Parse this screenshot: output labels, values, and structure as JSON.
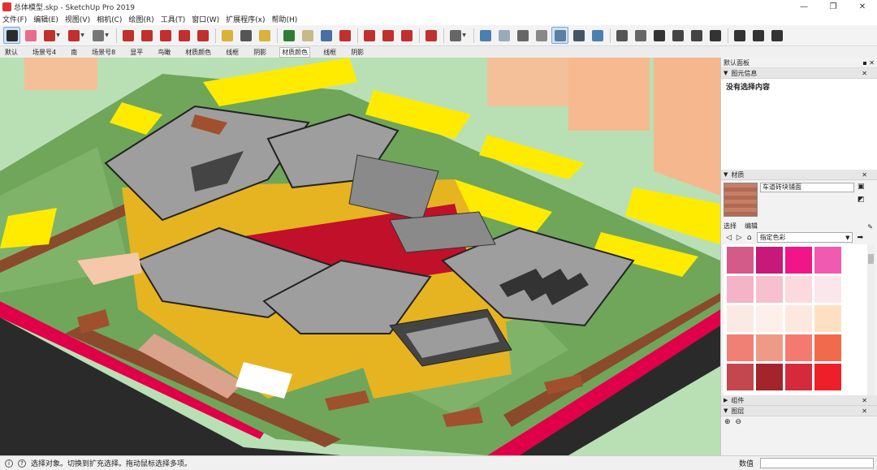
{
  "window": {
    "title": "总体模型.skp - SketchUp Pro 2019",
    "controls": [
      "—",
      "❐",
      "✕"
    ]
  },
  "menu": [
    "文件(F)",
    "编辑(E)",
    "视图(V)",
    "相机(C)",
    "绘图(R)",
    "工具(T)",
    "窗口(W)",
    "扩展程序(x)",
    "帮助(H)"
  ],
  "toolbar": {
    "tools": [
      {
        "name": "select-tool",
        "color": "#2b2b2b",
        "active": true
      },
      {
        "name": "eraser-tool",
        "color": "#e86b8b"
      },
      {
        "name": "pencil-tool",
        "color": "#c0302c",
        "dd": true
      },
      {
        "name": "arc-tool",
        "color": "#c0302c",
        "dd": true
      },
      {
        "name": "shape-tool",
        "color": "#777",
        "dd": true
      },
      {
        "name": "sep"
      },
      {
        "name": "push-pull-tool",
        "color": "#c0302c"
      },
      {
        "name": "follow-me-tool",
        "color": "#c0302c"
      },
      {
        "name": "move-tool",
        "color": "#c0302c"
      },
      {
        "name": "rotate-tool",
        "color": "#c0302c"
      },
      {
        "name": "scale-tool",
        "color": "#c0302c"
      },
      {
        "name": "sep"
      },
      {
        "name": "tape-measure-tool",
        "color": "#d9b23a"
      },
      {
        "name": "text-tool",
        "color": "#555"
      },
      {
        "name": "paint-bucket-tool",
        "color": "#d9b23a"
      },
      {
        "name": "sep"
      },
      {
        "name": "orbit-tool",
        "color": "#2e7d32"
      },
      {
        "name": "pan-tool",
        "color": "#c8b88a"
      },
      {
        "name": "zoom-tool",
        "color": "#4a6fa5"
      },
      {
        "name": "zoom-extents-tool",
        "color": "#c0302c"
      },
      {
        "name": "sep"
      },
      {
        "name": "3d-warehouse-icon",
        "color": "#c0302c"
      },
      {
        "name": "extension-warehouse-icon",
        "color": "#c0302c"
      },
      {
        "name": "layout-icon",
        "color": "#c0302c"
      },
      {
        "name": "sep"
      },
      {
        "name": "ruby-icon",
        "color": "#c0302c"
      },
      {
        "name": "sep"
      },
      {
        "name": "account-icon",
        "color": "#666",
        "dd": true
      },
      {
        "name": "sep"
      },
      {
        "name": "xray-icon",
        "color": "#4a7fb0"
      },
      {
        "name": "back-edges-icon",
        "color": "#9ab"
      },
      {
        "name": "wireframe-icon",
        "color": "#666"
      },
      {
        "name": "hidden-line-icon",
        "color": "#888"
      },
      {
        "name": "shaded-icon",
        "color": "#5a7fa0",
        "active": true
      },
      {
        "name": "shaded-texture-icon",
        "color": "#456"
      },
      {
        "name": "monochrome-icon",
        "color": "#4a7fb0"
      },
      {
        "name": "sep"
      },
      {
        "name": "iso-view-icon",
        "color": "#555"
      },
      {
        "name": "top-view-icon",
        "color": "#666"
      },
      {
        "name": "front-view-icon",
        "color": "#333"
      },
      {
        "name": "right-view-icon",
        "color": "#444"
      },
      {
        "name": "back-view-icon",
        "color": "#444"
      },
      {
        "name": "left-view-icon",
        "color": "#333"
      },
      {
        "name": "sep"
      },
      {
        "name": "plugin-icon-1",
        "color": "#333"
      },
      {
        "name": "plugin-icon-2",
        "color": "#333"
      },
      {
        "name": "plugin-icon-3",
        "color": "#333"
      }
    ]
  },
  "scenes": [
    {
      "label": "默认"
    },
    {
      "label": "场景号4"
    },
    {
      "label": "南"
    },
    {
      "label": "场景号8"
    },
    {
      "label": "显平"
    },
    {
      "label": "鸟瞰"
    },
    {
      "label": "材质颜色"
    },
    {
      "label": "线框"
    },
    {
      "label": "阴影"
    },
    {
      "label": "材质颜色",
      "active": true
    },
    {
      "label": "线框"
    },
    {
      "label": "阴影"
    }
  ],
  "tray": {
    "title": "默认面板",
    "ctrl": "▪ ✕",
    "entity_info": {
      "title": "图元信息",
      "content": "没有选择内容"
    },
    "materials": {
      "title": "材质",
      "material_name": "车道砖块铺面",
      "tabs": [
        "选择",
        "编辑"
      ],
      "library": "指定色彩",
      "swatches": [
        "#d45a8a",
        "#c6197a",
        "#f0168a",
        "#f15ab0",
        "#f4b3c6",
        "#f6c0cc",
        "#fbd9dd",
        "#fbe6ec",
        "#fbeae4",
        "#fdf0ea",
        "#fde8df",
        "#fde0c2",
        "#f08076",
        "#ef9a86",
        "#f47a70",
        "#f26a4c",
        "#c4474d",
        "#a3242b",
        "#d42a3a",
        "#ef1f2a"
      ]
    },
    "components": {
      "title": "组件"
    },
    "layers": {
      "title": "图层"
    }
  },
  "status": {
    "message": "选择对象。切换到扩充选择。拖动鼠标选择多项。",
    "value_label": "数值"
  }
}
